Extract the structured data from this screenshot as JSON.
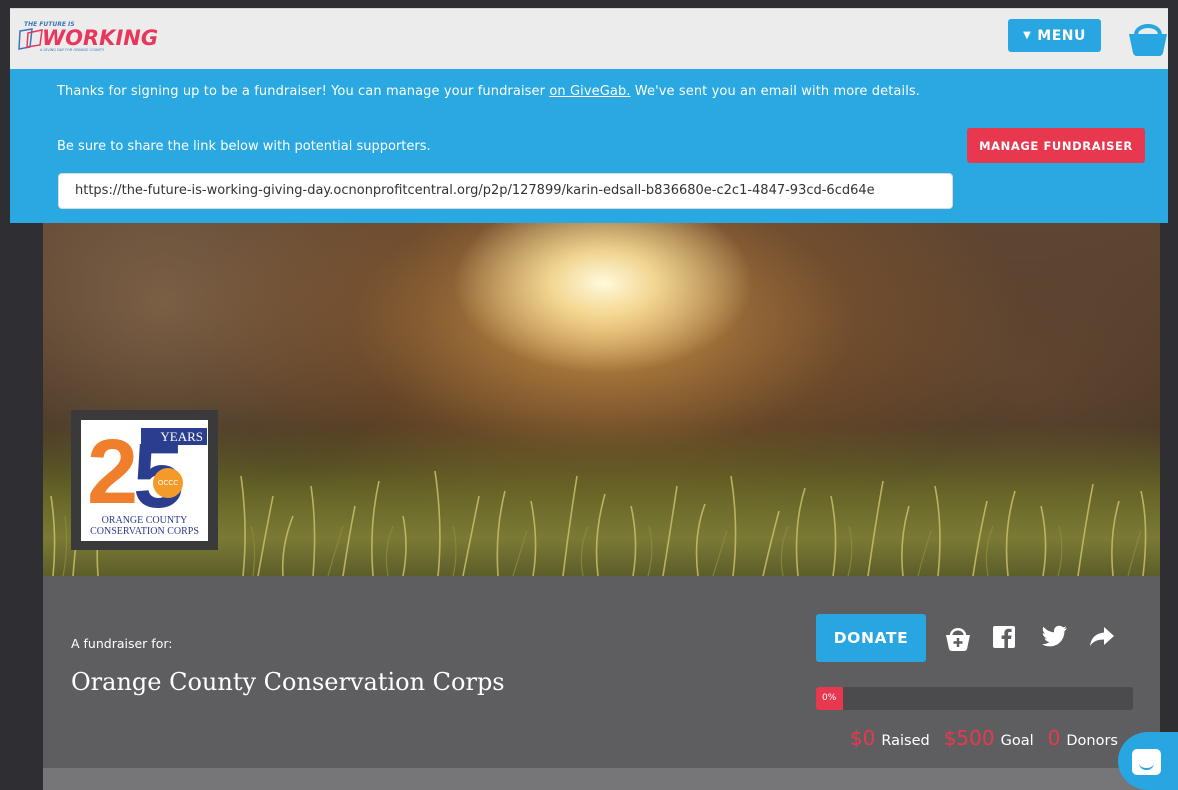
{
  "header": {
    "logo_small": "THE FUTURE IS",
    "logo_word": "WORKING",
    "logo_tagline": "A GIVING DAY FOR ORANGE COUNTY",
    "menu_label": "MENU",
    "basket_icon": "basket-icon"
  },
  "banner": {
    "message_before": "Thanks for signing up to be a fundraiser! You can manage your fundraiser ",
    "message_link": "on GiveGab.",
    "message_after": " We've sent you an email with more details.",
    "share_prompt": "Be sure to share the link below with potential supporters.",
    "manage_label": "MANAGE FUNDRAISER",
    "share_url": "https://the-future-is-working-giving-day.ocnonprofitcentral.org/p2p/127899/karin-edsall-b836680e-c2c1-4847-93cd-6cd64e"
  },
  "org_logo": {
    "years_label": "YEARS",
    "number_two": "2",
    "number_five": "5",
    "badge": "OCCC",
    "name_line1": "ORANGE COUNTY",
    "name_line2": "CONSERVATION CORPS"
  },
  "fundraiser": {
    "for_label": "A fundraiser for:",
    "org_name": "Orange County Conservation Corps",
    "donate_label": "DONATE",
    "progress_percent": 0,
    "progress_label": "0%",
    "raised_value": "$0",
    "raised_label": "Raised",
    "goal_value": "$500",
    "goal_label": "Goal",
    "donors_value": "0",
    "donors_label": "Donors"
  },
  "colors": {
    "accent_blue": "#29a8e1",
    "accent_red": "#e8384f",
    "band_gray": "#5e5e61"
  }
}
